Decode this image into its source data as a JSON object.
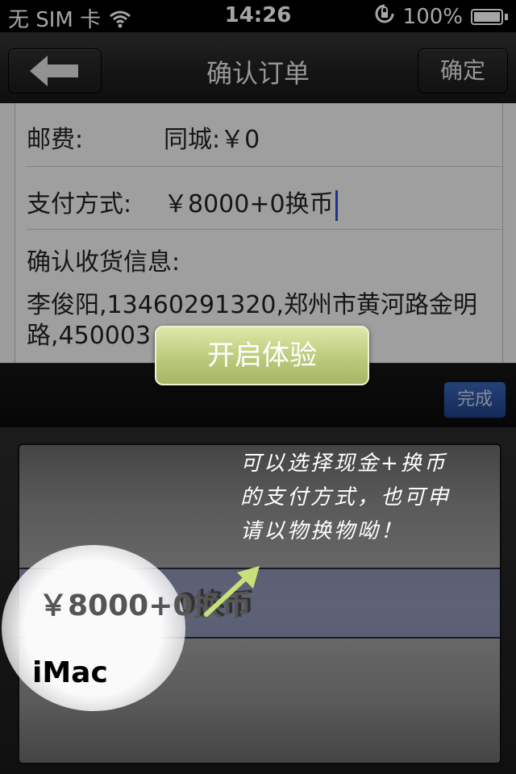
{
  "status_bar": {
    "carrier": "无 SIM 卡",
    "time": "14:26",
    "battery": "100%"
  },
  "nav": {
    "title": "确认订单",
    "confirm": "确定",
    "back_icon": "back-arrow-icon"
  },
  "order": {
    "postage_label": "邮费:",
    "postage_value": "同城:￥0",
    "payment_label": "支付方式:",
    "payment_value": "￥8000+0换币",
    "receipt_label": "确认收货信息:",
    "address_line1": " 李俊阳,13460291320,郑州市黄河路金明",
    "address_line2": "路,450003"
  },
  "toolbar": {
    "done": "完成"
  },
  "picker": {
    "options": [
      "￥8000+0换币",
      "iMac"
    ],
    "selected_index": 0
  },
  "tutorial": {
    "button": "开启体验",
    "hint_lines": [
      "可以选择现金+换币",
      "的支付方式，也可申",
      "请以物换物呦！"
    ]
  },
  "colors": {
    "accent_blue": "#2b4fd8",
    "done_button": "#2f56a6",
    "start_button": "#b8c878",
    "arrow": "#c8e07a"
  }
}
